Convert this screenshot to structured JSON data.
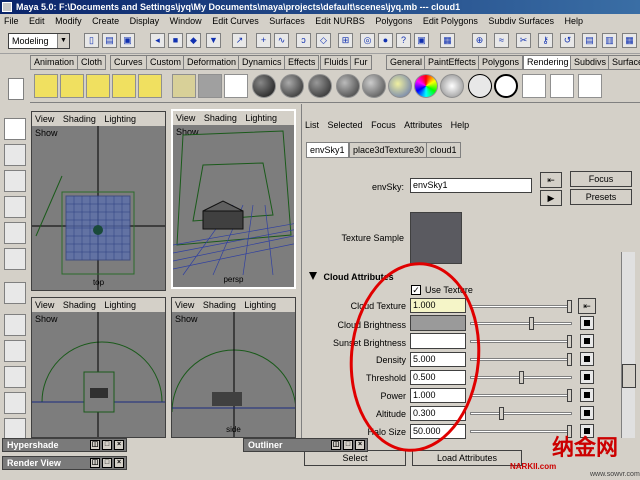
{
  "window": {
    "title": "Maya 5.0: F:\\Documents and Settings\\jyq\\My Documents\\maya\\projects\\default\\scenes\\jyq.mb  ---  cloud1"
  },
  "menubar": [
    "File",
    "Edit",
    "Modify",
    "Create",
    "Display",
    "Window",
    "Edit Curves",
    "Surfaces",
    "Edit NURBS",
    "Polygons",
    "Edit Polygons",
    "Subdiv Surfaces",
    "Help"
  ],
  "toolbar": {
    "mode": "Modeling"
  },
  "shelf_tabs": [
    "Animation",
    "Cloth",
    "Curves",
    "Custom",
    "Deformation",
    "Dynamics",
    "Effects",
    "Fluids",
    "Fur",
    "General",
    "PaintEffects",
    "Polygons",
    "Rendering",
    "Subdivs",
    "Surfaces"
  ],
  "shelf_active_tab": "Rendering",
  "viewports": {
    "menu": [
      "View",
      "Shading",
      "Lighting",
      "Show"
    ],
    "top_label": "top",
    "persp_label": "persp",
    "side_label": "side"
  },
  "attr_editor": {
    "menu": [
      "List",
      "Selected",
      "Focus",
      "Attributes",
      "Help"
    ],
    "node_tabs": [
      "envSky1",
      "place3dTexture30",
      "cloud1"
    ],
    "env_label": "envSky:",
    "env_value": "envSky1",
    "focus_btn": "Focus",
    "presets_btn": "Presets",
    "sample_label": "Texture Sample",
    "section_title": "Cloud Attributes",
    "use_texture": "Use Texture",
    "attrs": [
      {
        "label": "Cloud Texture",
        "value": "1.000"
      },
      {
        "label": "Cloud Brightness",
        "value": ""
      },
      {
        "label": "Sunset Brightness",
        "value": ""
      },
      {
        "label": "Density",
        "value": "5.000"
      },
      {
        "label": "Threshold",
        "value": "0.500"
      },
      {
        "label": "Power",
        "value": "1.000"
      },
      {
        "label": "Altitude",
        "value": "0.300"
      },
      {
        "label": "Halo Size",
        "value": "50.000"
      }
    ],
    "select_btn": "Select",
    "load_btn": "Load Attributes"
  },
  "floating": {
    "hypershade": "Hypershade",
    "outliner": "Outliner",
    "render_view": "Render View"
  },
  "watermark": {
    "text": "纳金网",
    "url": "NARKII.com",
    "site": "www.sowvr.com"
  },
  "colors": {
    "title_bar": "#0a246a",
    "viewport_bg": "#7d7d7d",
    "cloud_texture_field": "#f5f5c8",
    "annotation_red": "#e00000"
  }
}
